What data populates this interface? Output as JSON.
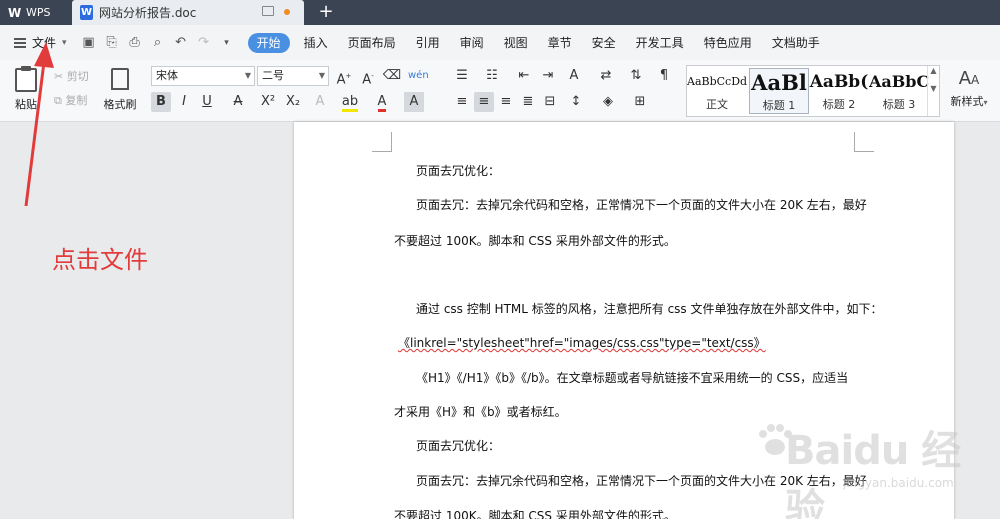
{
  "titlebar": {
    "app_name": "WPS",
    "doc_tab": "网站分析报告.doc",
    "new_tab": "+"
  },
  "menu": {
    "file": "文件",
    "items": [
      "开始",
      "插入",
      "页面布局",
      "引用",
      "审阅",
      "视图",
      "章节",
      "安全",
      "开发工具",
      "特色应用",
      "文档助手"
    ],
    "active_index": 0
  },
  "ribbon": {
    "paste": "粘贴",
    "cut": "剪切",
    "copy": "复制",
    "format_painter": "格式刷",
    "font_name": "宋体",
    "font_size": "二号",
    "styles": [
      {
        "preview": "AaBbCcDd",
        "name": "正文"
      },
      {
        "preview": "AaBl",
        "name": "标题 1"
      },
      {
        "preview": "AaBb(",
        "name": "标题 2"
      },
      {
        "preview": "AaBbC",
        "name": "标题 3"
      }
    ],
    "new_style": "新样式"
  },
  "document": {
    "lines": [
      "页面去冗优化：",
      "页面去冗：去掉冗余代码和空格，正常情况下一个页面的文件大小在 20K 左右，最好",
      "不要超过 100K。脚本和 CSS 采用外部文件的形式。",
      "通过 css 控制 HTML 标签的风格，注意把所有 css 文件单独存放在外部文件中，如下：",
      "《linkrel=\"stylesheet\"href=\"images/css.css\"type=\"text/css》",
      "《H1》《/H1》《b》《/b》。在文章标题或者导航链接不宜采用统一的 CSS，应适当",
      "才采用《H》和《b》或者标红。",
      "页面去冗优化：",
      "页面去冗：去掉冗余代码和空格，正常情况下一个页面的文件大小在 20K 左右，最好",
      "不要超过 100K。脚本和 CSS 采用外部文件的形式。"
    ]
  },
  "annotation": {
    "text": "点击文件",
    "color": "#e23b3b"
  },
  "watermark": {
    "brand": "Baidu 经验",
    "url": "jingyan.baidu.com"
  }
}
